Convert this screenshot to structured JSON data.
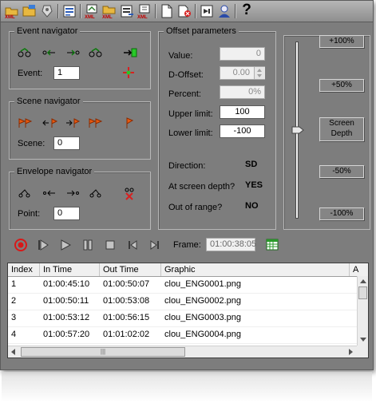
{
  "event_navigator": {
    "title": "Event navigator",
    "field_label": "Event:",
    "value": "1"
  },
  "scene_navigator": {
    "title": "Scene navigator",
    "field_label": "Scene:",
    "value": "0"
  },
  "envelope_navigator": {
    "title": "Envelope navigator",
    "field_label": "Point:",
    "value": "0"
  },
  "offset": {
    "title": "Offset parameters",
    "value_label": "Value:",
    "value": "0",
    "doffset_label": "D-Offset:",
    "doffset": "0.00",
    "percent_label": "Percent:",
    "percent": "0%",
    "upper_label": "Upper limit:",
    "upper": "100",
    "lower_label": "Lower limit:",
    "lower": "-100",
    "direction_label": "Direction:",
    "direction": "SD",
    "screen_depth_label": "At screen depth?",
    "screen_depth": "YES",
    "range_label": "Out of range?",
    "range": "NO"
  },
  "slider": {
    "b_plus100": "+100%",
    "b_plus50": "+50%",
    "b_screen1": "Screen",
    "b_screen2": "Depth",
    "b_minus50": "-50%",
    "b_minus100": "-100%",
    "level_percent": 0
  },
  "transport": {
    "frame_label": "Frame:",
    "frame_value": "01:00:38:05"
  },
  "table": {
    "columns": [
      "Index",
      "In Time",
      "Out Time",
      "Graphic",
      "A"
    ],
    "rows": [
      {
        "index": "1",
        "in": "01:00:45:10",
        "out": "01:00:50:07",
        "graphic": "clou_ENG0001.png"
      },
      {
        "index": "2",
        "in": "01:00:50:11",
        "out": "01:00:53:08",
        "graphic": "clou_ENG0002.png"
      },
      {
        "index": "3",
        "in": "01:00:53:12",
        "out": "01:00:56:15",
        "graphic": "clou_ENG0003.png"
      },
      {
        "index": "4",
        "in": "01:00:57:20",
        "out": "01:01:02:02",
        "graphic": "clou_ENG0004.png"
      }
    ]
  },
  "toolbar": {
    "help_label": "?"
  },
  "icons": [
    "open-xml-icon",
    "open-folder-icon",
    "tag-icon",
    "list-icon",
    "export-xml-icon",
    "import-xml-icon",
    "cut-icon",
    "save-xml-icon",
    "new-document-icon",
    "paste-icon",
    "go-icon",
    "user-icon",
    "help-icon"
  ]
}
